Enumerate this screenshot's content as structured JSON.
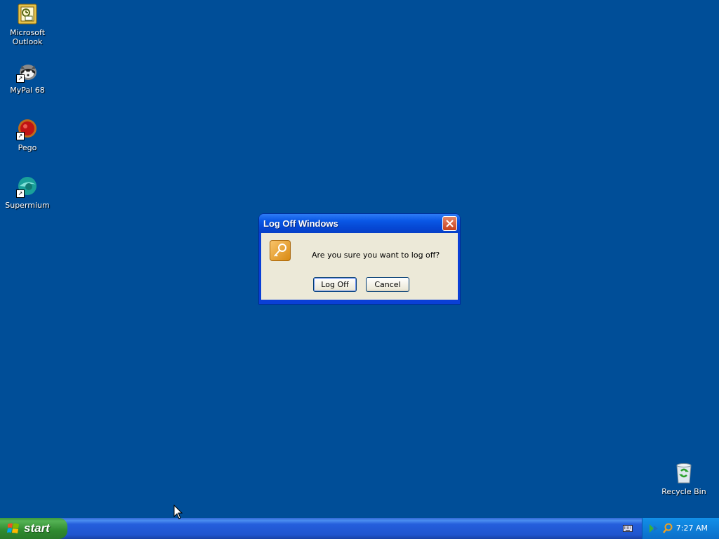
{
  "desktop": {
    "background": "#004e98",
    "icons": [
      {
        "label": "Microsoft Outlook",
        "icon": "outlook-icon"
      },
      {
        "label": "MyPal 68",
        "icon": "mypal-icon"
      },
      {
        "label": "Pego",
        "icon": "pego-icon"
      },
      {
        "label": "Supermium",
        "icon": "supermium-icon"
      },
      {
        "label": "Recycle Bin",
        "icon": "recycle-bin-icon"
      }
    ]
  },
  "dialog": {
    "title": "Log Off Windows",
    "message": "Are you sure you want to log off?",
    "logoff_label": "Log Off",
    "cancel_label": "Cancel"
  },
  "taskbar": {
    "start_label": "start",
    "clock": "7:27 AM"
  }
}
